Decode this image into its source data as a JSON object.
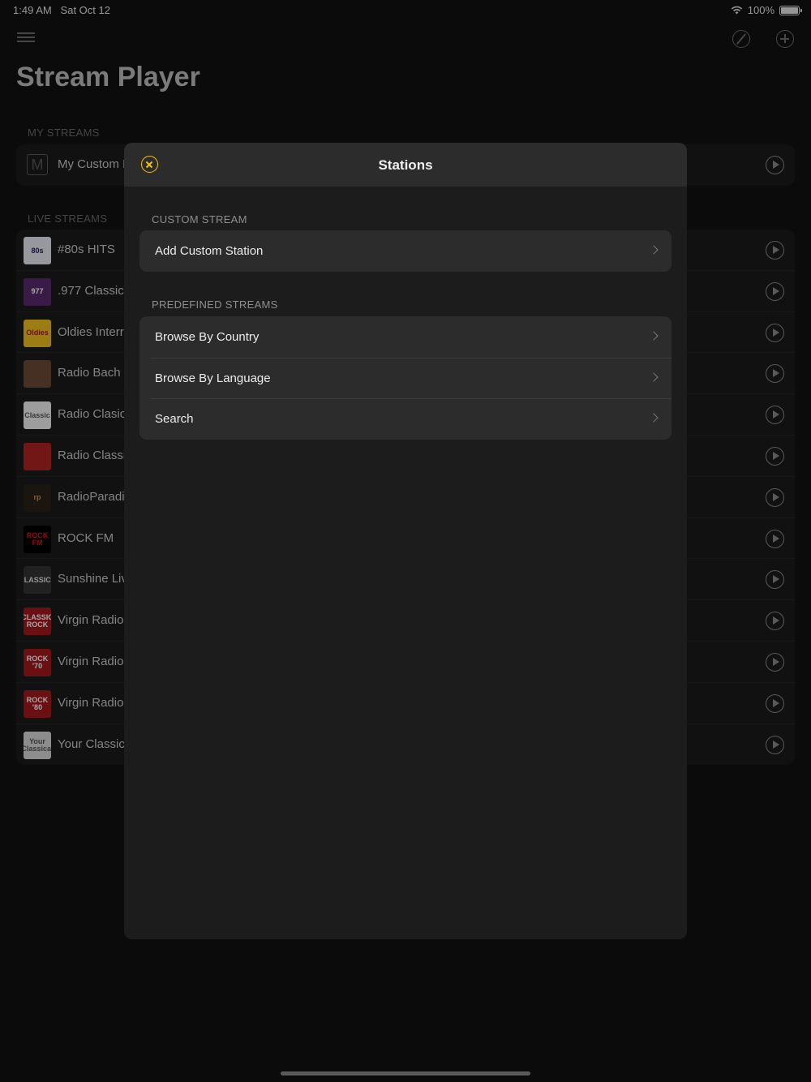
{
  "status_bar": {
    "time": "1:49 AM",
    "date": "Sat Oct 12",
    "battery": "100%"
  },
  "app": {
    "title": "Stream Player",
    "my_streams_header": "MY STREAMS",
    "my_streams": [
      {
        "name": "My Custom I",
        "thumb": "M"
      }
    ],
    "live_streams_header": "LIVE STREAMS",
    "live_streams": [
      {
        "name": "#80s HITS",
        "thumb": "80s",
        "bg": "#e9e9f3",
        "fg": "#1b1b5a"
      },
      {
        "name": ".977 Classic",
        "thumb": "977",
        "bg": "#5a2a6e",
        "fg": "#ffffff"
      },
      {
        "name": "Oldies Interr",
        "thumb": "Oldies",
        "bg": "#f0c020",
        "fg": "#a0200a"
      },
      {
        "name": "Radio Bach",
        "thumb": "",
        "bg": "#6b4a36",
        "fg": "#ffffff"
      },
      {
        "name": "Radio Clasic",
        "thumb": "Classic",
        "bg": "#f2f2f2",
        "fg": "#555555"
      },
      {
        "name": "Radio Classi",
        "thumb": "",
        "bg": "#b02222",
        "fg": "#ffffff"
      },
      {
        "name": "RadioParadis",
        "thumb": "rp",
        "bg": "#2a2118",
        "fg": "#d08a50"
      },
      {
        "name": "ROCK FM",
        "thumb": "ROCK FM",
        "bg": "#000000",
        "fg": "#e01010"
      },
      {
        "name": "Sunshine Liv",
        "thumb": "CLASSICS",
        "bg": "#333333",
        "fg": "#e0e0e0"
      },
      {
        "name": "Virgin Radio",
        "thumb": "CLASSIC ROCK",
        "bg": "#a3171d",
        "fg": "#ffffff"
      },
      {
        "name": "Virgin Radio",
        "thumb": "ROCK '70",
        "bg": "#a3171d",
        "fg": "#ffffff"
      },
      {
        "name": "Virgin Radio",
        "thumb": "ROCK '80",
        "bg": "#a3171d",
        "fg": "#ffffff"
      },
      {
        "name": "Your Classic",
        "thumb": "Your Classical",
        "bg": "#d9d9d9",
        "fg": "#555555"
      }
    ]
  },
  "modal": {
    "title": "Stations",
    "custom_header": "CUSTOM STREAM",
    "custom_items": [
      {
        "label": "Add Custom Station"
      }
    ],
    "predefined_header": "PREDEFINED STREAMS",
    "predefined_items": [
      {
        "label": "Browse By Country"
      },
      {
        "label": "Browse By Language"
      },
      {
        "label": "Search"
      }
    ]
  },
  "colors": {
    "accent": "#f2c10f",
    "background": "#111111",
    "modal_bg": "#1c1c1c",
    "cell_bg": "#2c2c2c"
  }
}
